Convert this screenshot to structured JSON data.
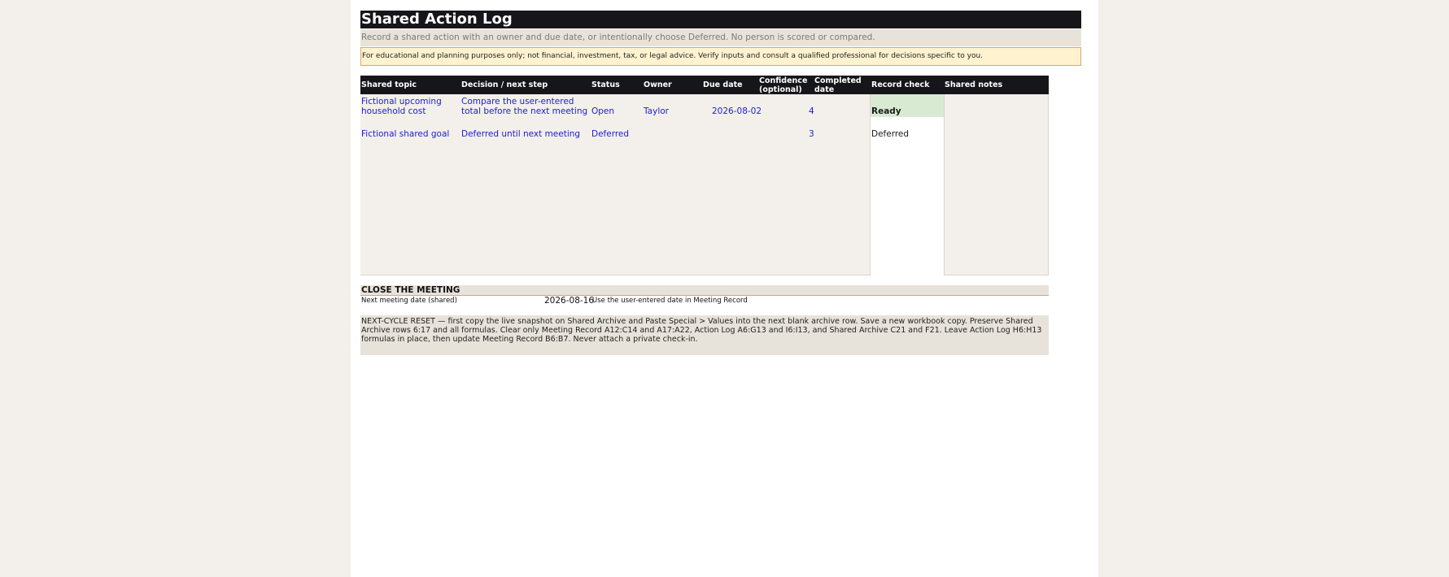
{
  "title": "Shared Action Log",
  "subtitle": "Record a shared action with an owner and due date, or intentionally choose Deferred. No person is scored or compared.",
  "disclaimer": "For educational and planning purposes only; not financial, investment, tax, or legal advice. Verify inputs and consult a qualified professional for decisions specific to you.",
  "columns": [
    "Shared topic",
    "Decision / next step",
    "Status",
    "Owner",
    "Due date",
    "Confidence (optional)",
    "Completed date",
    "Record check",
    "Shared notes"
  ],
  "rows": [
    {
      "topic": "Fictional upcoming household cost",
      "decision": "Compare the user-entered total before the next meeting",
      "status": "Open",
      "owner": "Taylor",
      "due_date": "2026-08-02",
      "confidence": "4",
      "completed_date": "",
      "record_check": "Ready",
      "notes": ""
    },
    {
      "topic": "Fictional shared goal",
      "decision": "Deferred until next meeting",
      "status": "Deferred",
      "owner": "",
      "due_date": "",
      "confidence": "3",
      "completed_date": "",
      "record_check": "Deferred",
      "notes": ""
    }
  ],
  "close": {
    "title": "CLOSE THE MEETING",
    "next_meeting_label": "Next meeting date (shared)",
    "next_meeting_date": "2026-08-16",
    "next_meeting_note": "Use the user-entered date in Meeting Record"
  },
  "reset_text": "NEXT-CYCLE RESET — first copy the live snapshot on Shared Archive and Paste Special > Values into the next blank archive row. Save a new workbook copy. Preserve Shared Archive rows 6:17 and all formulas. Clear only Meeting Record A12:C14 and A17:A22, Action Log A6:G13 and I6:I13, and Shared Archive C21 and F21. Leave Action Log H6:H13 formulas in place, then update Meeting Record B6:B7. Never attach a private check-in.",
  "colors": {
    "header_bg": "#16161a",
    "input_text": "#1b1bd6",
    "ready_bg": "#d9ead3",
    "disclaimer_bg": "#fff2cf",
    "disclaimer_border": "#e3a46a"
  }
}
